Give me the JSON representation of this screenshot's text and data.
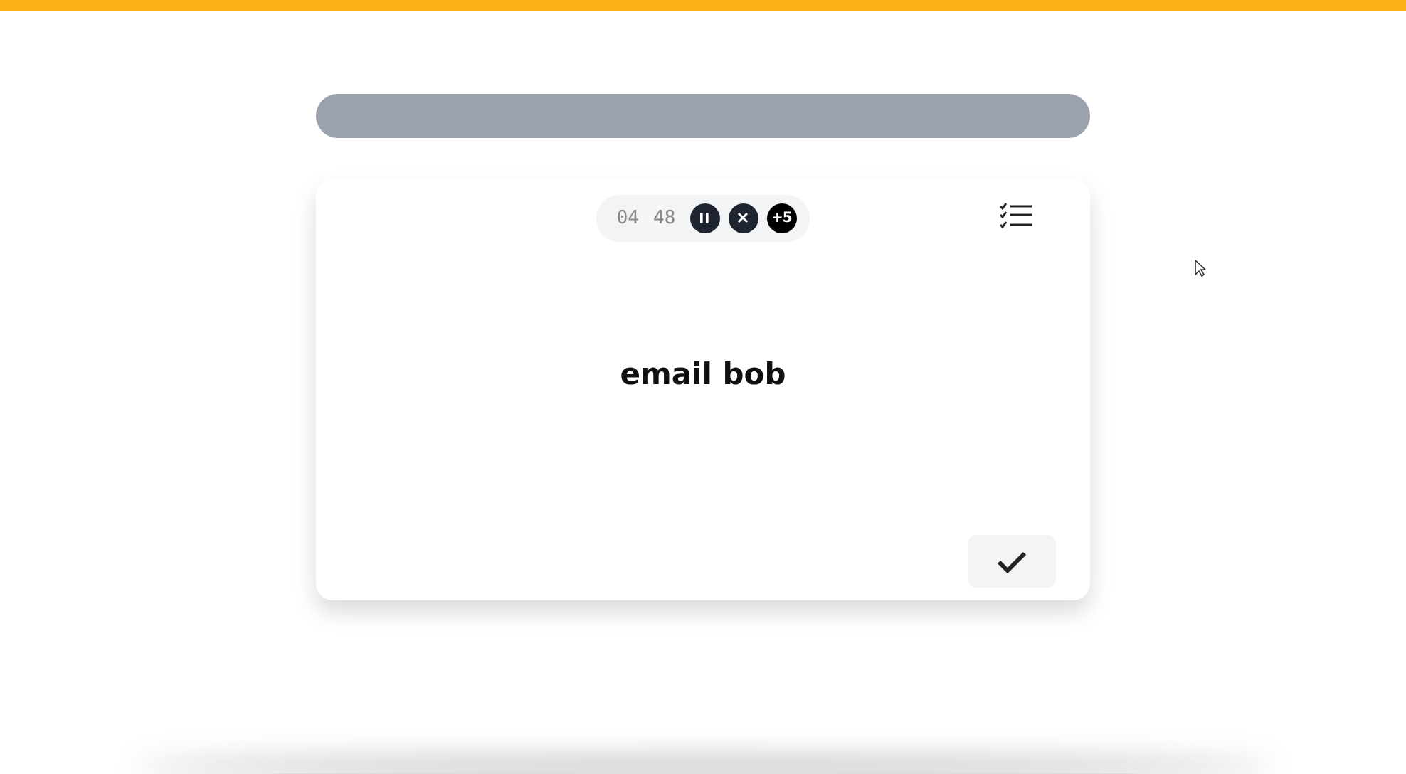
{
  "timer": {
    "minutes": "04",
    "seconds": "48",
    "paused": false,
    "bonus": "+5"
  },
  "task": {
    "title": "email bob"
  }
}
